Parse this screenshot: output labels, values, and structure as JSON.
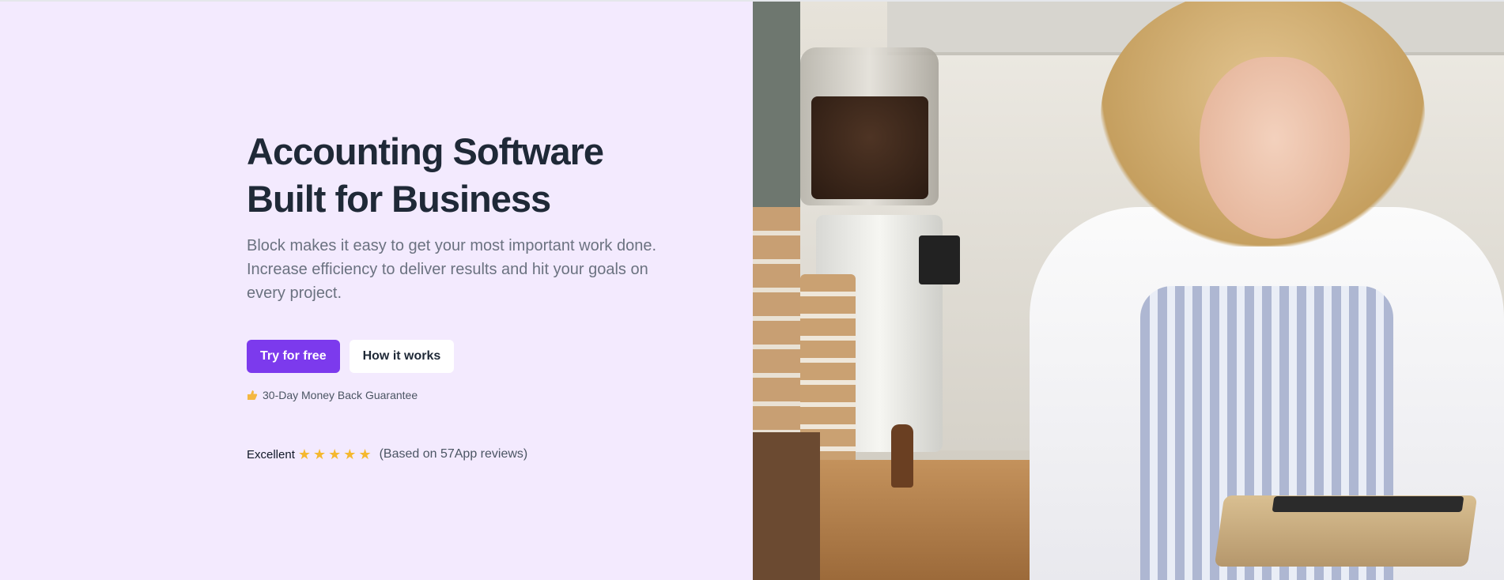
{
  "hero": {
    "title_line1": "Accounting Software",
    "title_line2": "Built for Business",
    "subtitle": "Block makes it easy to get your most important work done. Increase efficiency to deliver results and hit your goals on every project.",
    "primary_cta": "Try for free",
    "secondary_cta": "How it works",
    "guarantee_text": "30-Day Money Back Guarantee",
    "guarantee_icon": "hand-thumb-icon"
  },
  "rating": {
    "label": "Excellent",
    "stars": 5,
    "star_icon": "star-icon",
    "reviews_text": "(Based on 57App reviews)"
  },
  "colors": {
    "background": "#f3eafe",
    "primary": "#7c3aed",
    "heading": "#1f2937",
    "body": "#6b7280",
    "star": "#f5b82e"
  },
  "image": {
    "description_name": "hero-photo"
  }
}
